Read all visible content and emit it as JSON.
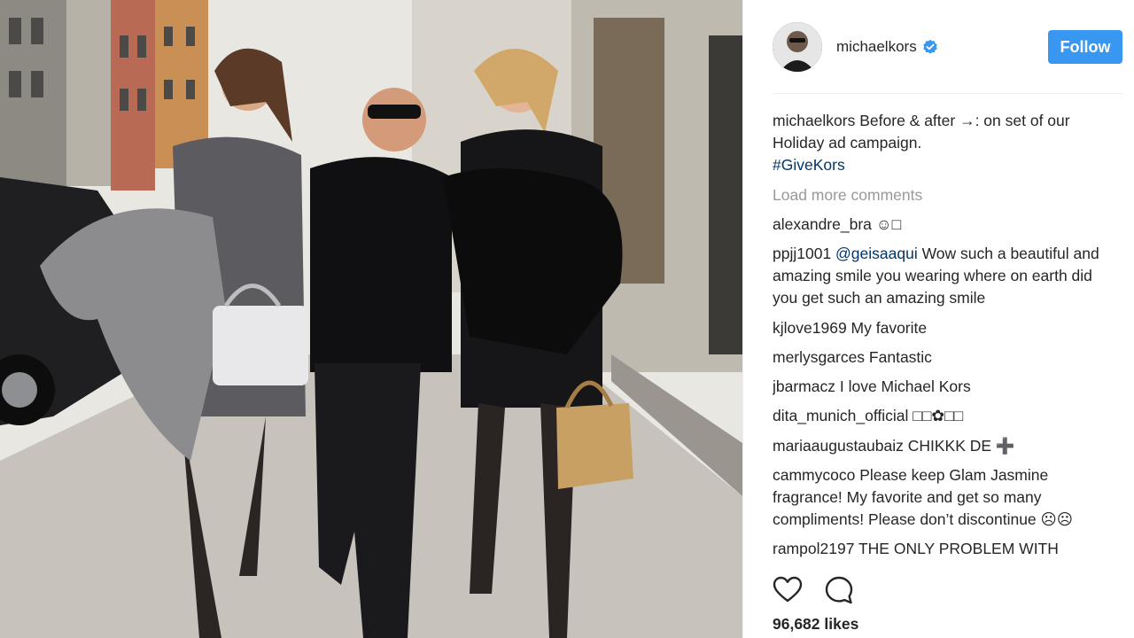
{
  "post": {
    "author": "michaelkors",
    "verified": true,
    "follow_label": "Follow",
    "caption": {
      "user": "michaelkors",
      "text": " Before & after →: on set of our Holiday ad campaign. ",
      "hashtag": "#GiveKors"
    },
    "load_more": "Load more comments",
    "likes": "96,682 likes"
  },
  "comments": [
    {
      "user": "alexandre_bra",
      "text": " ☺︎□",
      "mention": ""
    },
    {
      "user": "ppjj1001",
      "mention": "@geisaaqui",
      "text": " Wow such a beautiful and amazing smile you wearing where on earth did you get such an amazing smile"
    },
    {
      "user": "kjlove1969",
      "mention": "",
      "text": " My favorite"
    },
    {
      "user": "merlysgarces",
      "mention": "",
      "text": " Fantastic"
    },
    {
      "user": "jbarmacz",
      "mention": "",
      "text": " I love Michael Kors"
    },
    {
      "user": "dita_munich_official",
      "mention": "",
      "text": " □□✿□□"
    },
    {
      "user": "mariaaugustaubaiz",
      "mention": "",
      "text": " CHIKKK DE ➕"
    },
    {
      "user": "cammycoco",
      "mention": "",
      "text": " Please keep Glam Jasmine fragrance! My favorite and get so many compliments! Please don’t discontinue ☹☹"
    },
    {
      "user": "rampol2197",
      "mention": "",
      "text": " THE ONLY PROBLEM WITH"
    }
  ],
  "icons": {
    "like": "heart-icon",
    "comment": "comment-bubble-icon",
    "verified": "verified-badge-icon"
  },
  "colors": {
    "follow_button": "#3897f0",
    "hashtag": "#003569",
    "muted": "#999999"
  }
}
